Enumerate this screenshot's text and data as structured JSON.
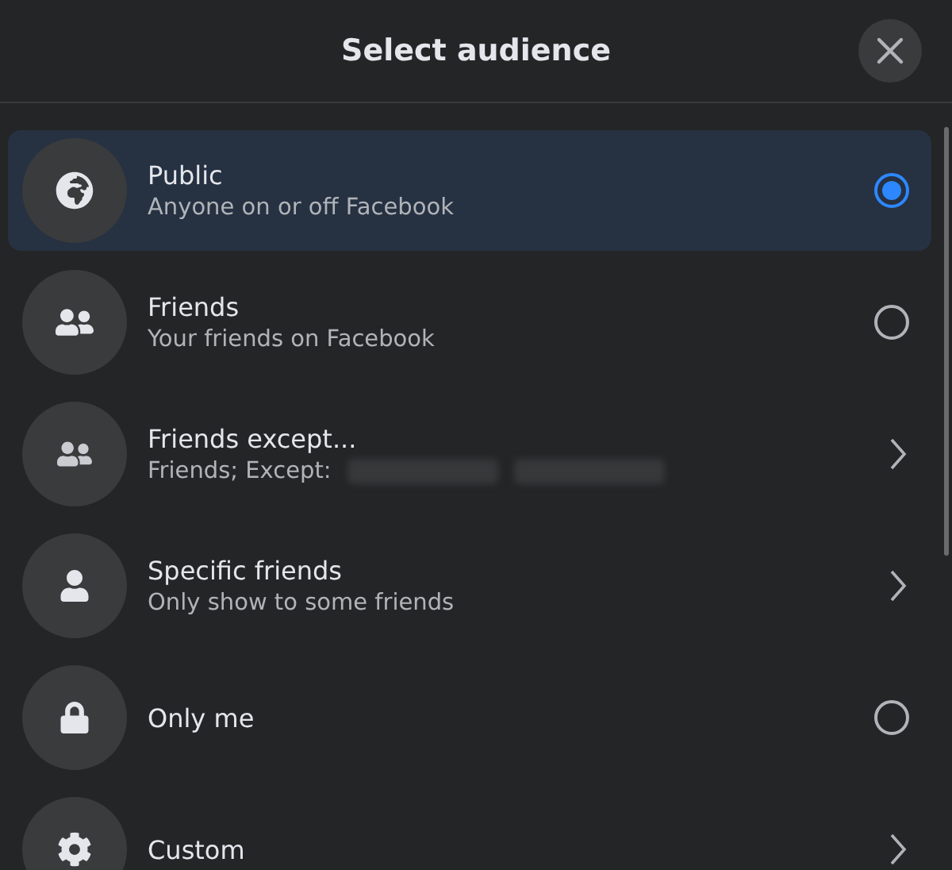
{
  "dialog": {
    "title": "Select audience"
  },
  "options": [
    {
      "title": "Public",
      "subtitle": "Anyone on or off Facebook",
      "kind": "radio",
      "selected": true
    },
    {
      "title": "Friends",
      "subtitle": "Your friends on Facebook",
      "kind": "radio",
      "selected": false
    },
    {
      "title": "Friends except...",
      "subtitle": "Friends; Except:",
      "kind": "chevron",
      "selected": false,
      "redacted": true
    },
    {
      "title": "Specific friends",
      "subtitle": "Only show to some friends",
      "kind": "chevron",
      "selected": false
    },
    {
      "title": "Only me",
      "kind": "radio",
      "selected": false
    },
    {
      "title": "Custom",
      "kind": "chevron",
      "selected": false
    }
  ]
}
